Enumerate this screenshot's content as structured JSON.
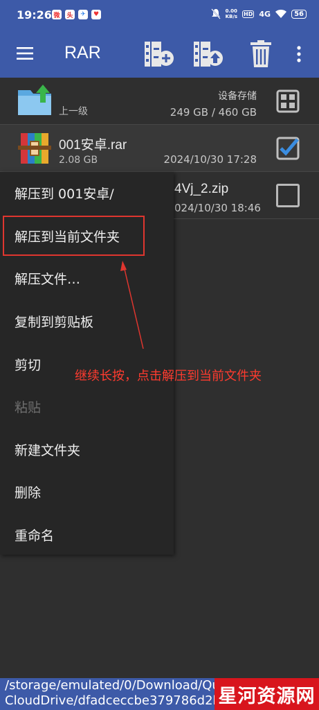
{
  "status_bar": {
    "time": "19:26",
    "net_speed": "0.00\nKB/s",
    "hd": "HD",
    "network": "4G",
    "battery": "56"
  },
  "app_bar": {
    "title": "RAR",
    "icons": [
      "menu-icon",
      "add-to-archive-icon",
      "extract-icon",
      "delete-icon",
      "more-options-icon"
    ],
    "accent_color": "#3d5aa8"
  },
  "files": [
    {
      "name": "上一级",
      "right_top": "设备存储",
      "right_bottom": "249 GB / 460 GB",
      "icon": "folder-up-icon"
    },
    {
      "name": "001安卓.rar",
      "size": "2.08 GB",
      "date": "2024/10/30 17:28",
      "checked": true,
      "icon": "winrar-archive-icon"
    },
    {
      "name_visible": "4Vj_2.zip",
      "date_visible": "024/10/30 18:46",
      "checked": false
    }
  ],
  "context_menu": {
    "items": [
      {
        "label": "解压到 001安卓/",
        "enabled": true
      },
      {
        "label": "解压到当前文件夹",
        "enabled": true
      },
      {
        "label": "解压文件…",
        "enabled": true
      },
      {
        "label": "复制到剪贴板",
        "enabled": true
      },
      {
        "label": "剪切",
        "enabled": true
      },
      {
        "label": "粘贴",
        "enabled": false
      },
      {
        "label": "新建文件夹",
        "enabled": true
      },
      {
        "label": "删除",
        "enabled": true
      },
      {
        "label": "重命名",
        "enabled": true
      }
    ]
  },
  "annotation": {
    "text": "继续长按，点击解压到当前文件夹",
    "color": "#e0362f"
  },
  "path_bar": {
    "line1": "/storage/emulated/0/Download/Quark/",
    "line2": "CloudDrive/dfadceccbe379786d2b8"
  },
  "watermark": {
    "text": "星河资源网",
    "color": "#d8151d"
  }
}
